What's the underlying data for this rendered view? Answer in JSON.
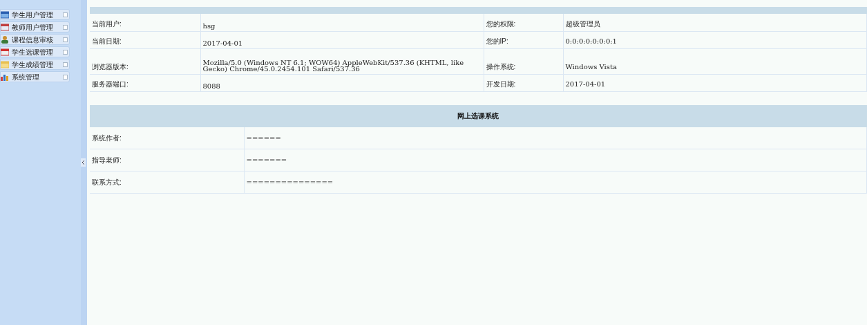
{
  "sidebar": {
    "items": [
      {
        "label": "学生用户管理"
      },
      {
        "label": "教师用户管理"
      },
      {
        "label": "课程信息审核"
      },
      {
        "label": "学生选课管理"
      },
      {
        "label": "学生成绩管理"
      },
      {
        "label": "系统管理"
      }
    ]
  },
  "info_table": {
    "rows": [
      {
        "label_1": "当前用户:",
        "value_1": "hsg",
        "label_2": "您的权限:",
        "value_2": "超级管理员"
      },
      {
        "label_1": "当前日期:",
        "value_1": "2017-04-01",
        "label_2": "您的IP:",
        "value_2": "0:0:0:0:0:0:0:1"
      },
      {
        "label_1": "浏览器版本:",
        "value_1": "Mozilla/5.0 (Windows NT 6.1; WOW64) AppleWebKit/537.36 (KHTML, like Gecko) Chrome/45.0.2454.101 Safari/537.36",
        "label_2": "操作系统:",
        "value_2": "Windows Vista"
      },
      {
        "label_1": "服务器端口:",
        "value_1": "8088",
        "label_2": "开发日期:",
        "value_2": "2017-04-01"
      }
    ]
  },
  "system_table": {
    "title": "网上选课系统",
    "rows": [
      {
        "label": "系统作者:",
        "value": "======"
      },
      {
        "label": "指导老师:",
        "value": "======="
      },
      {
        "label": "联系方式:",
        "value": "==============="
      }
    ]
  }
}
